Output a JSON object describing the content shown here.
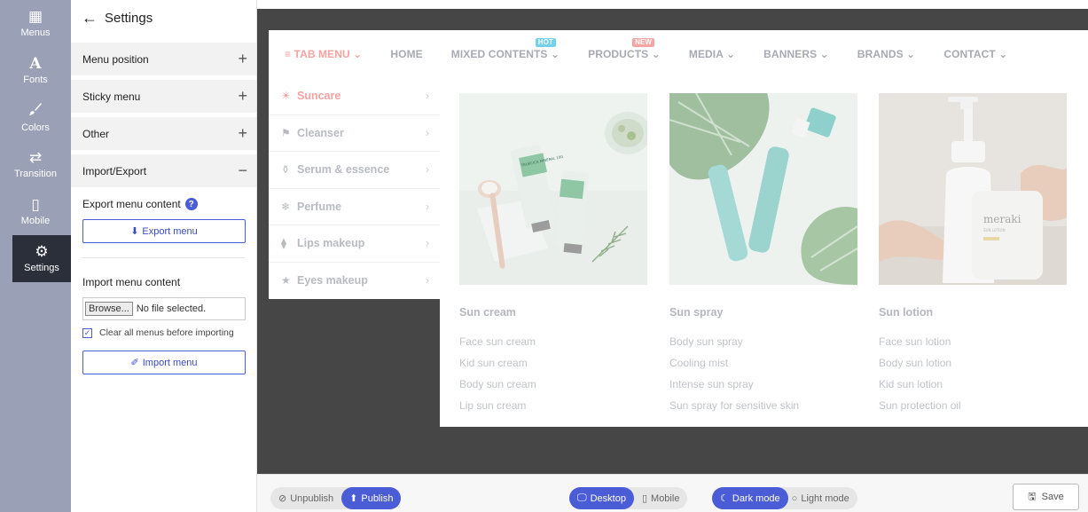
{
  "rail": [
    {
      "icon": "grid-icon",
      "glyph": "▦",
      "label": "Menus"
    },
    {
      "icon": "font-icon",
      "glyph": "A",
      "label": "Fonts"
    },
    {
      "icon": "brush-icon",
      "glyph": "🖌",
      "label": "Colors"
    },
    {
      "icon": "shuffle-icon",
      "glyph": "⇄",
      "label": "Transition"
    },
    {
      "icon": "mobile-icon",
      "glyph": "▯",
      "label": "Mobile"
    },
    {
      "icon": "gear-icon",
      "glyph": "⚙",
      "label": "Settings"
    }
  ],
  "panel": {
    "title": "Settings",
    "sections": [
      {
        "label": "Menu position",
        "sign": "+"
      },
      {
        "label": "Sticky menu",
        "sign": "+"
      },
      {
        "label": "Other",
        "sign": "+"
      },
      {
        "label": "Import/Export",
        "sign": "−"
      }
    ],
    "export_label": "Export menu content",
    "export_button": "Export menu",
    "import_label": "Import menu content",
    "browse_button": "Browse...",
    "file_status": "No file selected.",
    "clear_checkbox": "Clear all menus before importing",
    "import_button": "Import menu"
  },
  "preview": {
    "menu": [
      {
        "label": "≡ TAB MENU ⌄"
      },
      {
        "label": "HOME"
      },
      {
        "label": "MIXED CONTENTS ⌄",
        "badge": "HOT"
      },
      {
        "label": "PRODUCTS ⌄",
        "badge": "NEW"
      },
      {
        "label": "MEDIA ⌄"
      },
      {
        "label": "BANNERS ⌄"
      },
      {
        "label": "BRANDS ⌄"
      },
      {
        "label": "CONTACT ⌄"
      }
    ],
    "tabs": [
      {
        "icon": "sun-icon",
        "glyph": "☀",
        "label": "Suncare"
      },
      {
        "icon": "flag-icon",
        "glyph": "⚑",
        "label": "Cleanser"
      },
      {
        "icon": "bottle-icon",
        "glyph": "⚱",
        "label": "Serum & essence"
      },
      {
        "icon": "snowflake-icon",
        "glyph": "❄",
        "label": "Perfume"
      },
      {
        "icon": "lipstick-icon",
        "glyph": "⧫",
        "label": "Lips makeup"
      },
      {
        "icon": "star-icon",
        "glyph": "★",
        "label": "Eyes makeup"
      }
    ],
    "columns": [
      {
        "title": "Sun cream",
        "links": [
          "Face sun cream",
          "Kid sun cream",
          "Body sun cream",
          "Lip sun cream"
        ]
      },
      {
        "title": "Sun spray",
        "links": [
          "Body sun spray",
          "Cooling mist",
          "Intense sun spray",
          "Sun spray for sensitive skin"
        ]
      },
      {
        "title": "Sun lotion",
        "links": [
          "Face sun lotion",
          "Body sun lotion",
          "Kid sun lotion",
          "Sun protection oil"
        ]
      }
    ],
    "image_text": {
      "tube_brand": "TRUECICA MINERAL 100",
      "bottle_brand": "meraki",
      "bottle_sub": "SUN LOTION"
    }
  },
  "bottombar": {
    "unpublish": "Unpublish",
    "publish": "Publish",
    "desktop": "Desktop",
    "mobile": "Mobile",
    "dark": "Dark mode",
    "light": "Light mode",
    "save": "Save"
  }
}
